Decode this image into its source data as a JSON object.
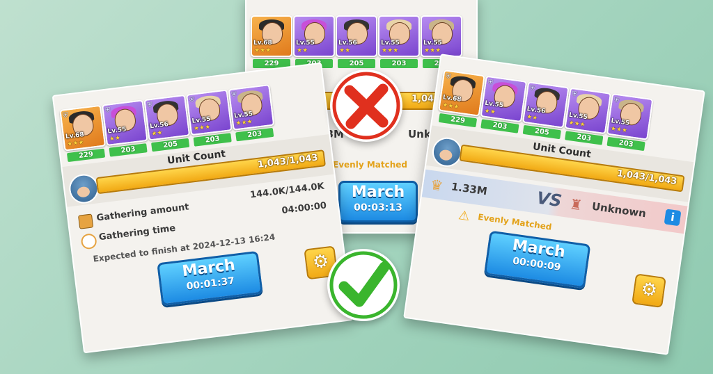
{
  "cards": {
    "top": {
      "levels": [
        "Lv.68",
        "Lv.55",
        "Lv.56",
        "Lv.55",
        "Lv.55"
      ],
      "counts": [
        "229",
        "203",
        "205",
        "203",
        "203"
      ],
      "unit_count": "1,043/1,043",
      "power": "1.33M",
      "enemy": "Unknown",
      "matchup": "Evenly Matched",
      "march_label": "March",
      "march_time": "00:03:13"
    },
    "left": {
      "levels": [
        "Lv.68",
        "Lv.55",
        "Lv.56",
        "Lv.55",
        "Lv.55"
      ],
      "counts": [
        "229",
        "203",
        "205",
        "203",
        "203"
      ],
      "unit_count_label": "Unit Count",
      "unit_count": "1,043/1,043",
      "gather_amount_label": "Gathering amount",
      "gather_amount": "144.0K/144.0K",
      "gather_time_label": "Gathering time",
      "gather_time": "04:00:00",
      "finish_text": "Expected to finish at 2024-12-13 16:24",
      "march_label": "March",
      "march_time": "00:01:37"
    },
    "right": {
      "levels": [
        "Lv.68",
        "Lv.55",
        "Lv.56",
        "Lv.55",
        "Lv.55"
      ],
      "counts": [
        "229",
        "203",
        "205",
        "203",
        "203"
      ],
      "unit_count_label": "Unit Count",
      "unit_count": "1,043/1,043",
      "power": "1.33M",
      "vs": "VS",
      "enemy": "Unknown",
      "matchup": "Evenly Matched",
      "info": "i",
      "march_label": "March",
      "march_time": "00:00:09"
    }
  },
  "marks": {
    "wrong": "wrong-mark-icon",
    "right": "check-mark-icon"
  },
  "colors": {
    "wrong": "#e0301e",
    "right": "#3ab52d",
    "march": "#1d8be3",
    "bar": "#f1a914",
    "count": "#3fc04b"
  }
}
